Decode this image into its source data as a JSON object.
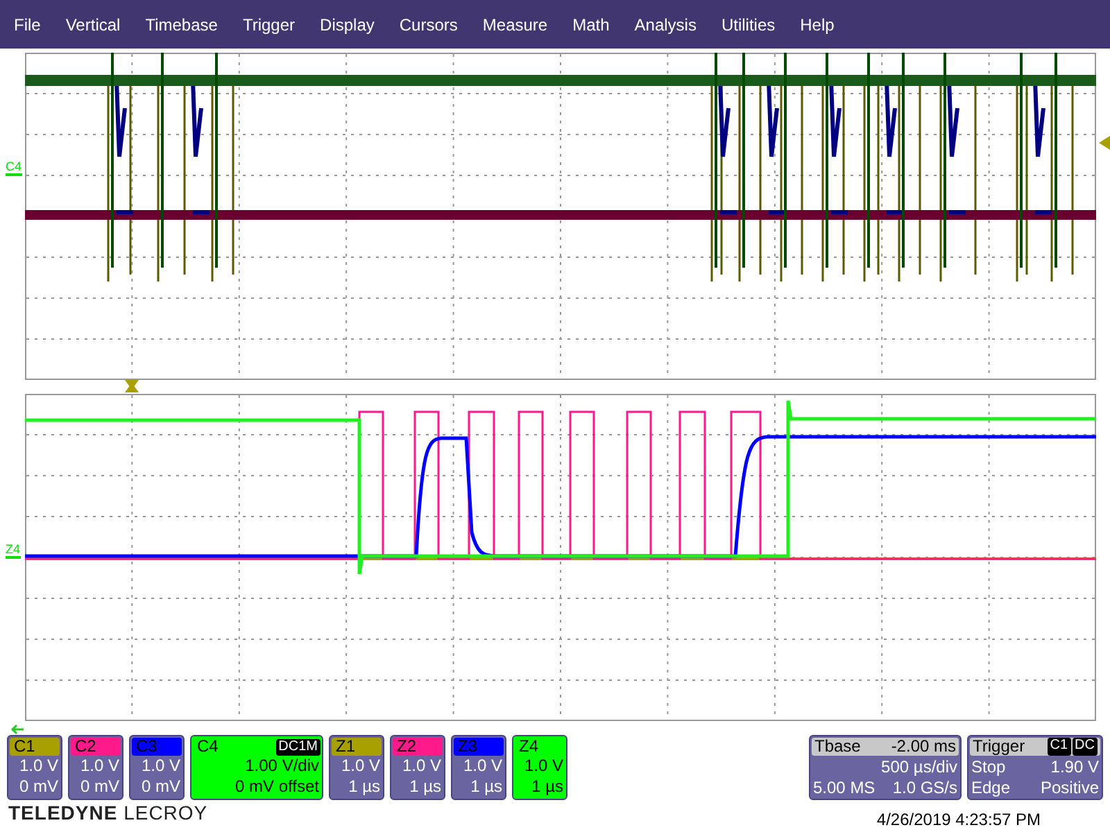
{
  "menu": [
    "File",
    "Vertical",
    "Timebase",
    "Trigger",
    "Display",
    "Cursors",
    "Measure",
    "Math",
    "Analysis",
    "Utilities",
    "Help"
  ],
  "grids": [
    {
      "trace_label": "C4"
    },
    {
      "trace_label": "Z4"
    }
  ],
  "channels": [
    {
      "name": "C1",
      "color": "#a8a000",
      "selected": false,
      "line1": "1.0 V",
      "line2": "0 mV"
    },
    {
      "name": "C2",
      "color": "#ff1a8c",
      "selected": false,
      "line1": "1.0 V",
      "line2": "0 mV"
    },
    {
      "name": "C3",
      "color": "#0000ff",
      "selected": false,
      "line1": "1.0 V",
      "line2": "0 mV"
    },
    {
      "name": "C4",
      "color": "#00ff00",
      "selected": true,
      "badge": "DC1M",
      "line1": "1.00 V/div",
      "line2": "0 mV offset"
    },
    {
      "name": "Z1",
      "color": "#a8a000",
      "selected": false,
      "line1": "1.0 V",
      "line2": "1 µs"
    },
    {
      "name": "Z2",
      "color": "#ff1a8c",
      "selected": false,
      "line1": "1.0 V",
      "line2": "1 µs"
    },
    {
      "name": "Z3",
      "color": "#0000ff",
      "selected": false,
      "line1": "1.0 V",
      "line2": "1 µs"
    },
    {
      "name": "Z4",
      "color": "#00ff00",
      "selected": true,
      "line1": "1.0 V",
      "line2": "1 µs"
    }
  ],
  "timebase": {
    "title": "Tbase",
    "delay": "-2.00 ms",
    "scale": "500 µs/div",
    "samples": "5.00 MS",
    "rate": "1.0 GS/s"
  },
  "trigger": {
    "title": "Trigger",
    "badges": [
      "C1",
      "DC"
    ],
    "mode": "Stop",
    "level": "1.90 V",
    "type": "Edge",
    "slope": "Positive"
  },
  "logo": "**TELEDYNE** LECROY",
  "timestamp": "4/26/2019 4:23:57 PM"
}
